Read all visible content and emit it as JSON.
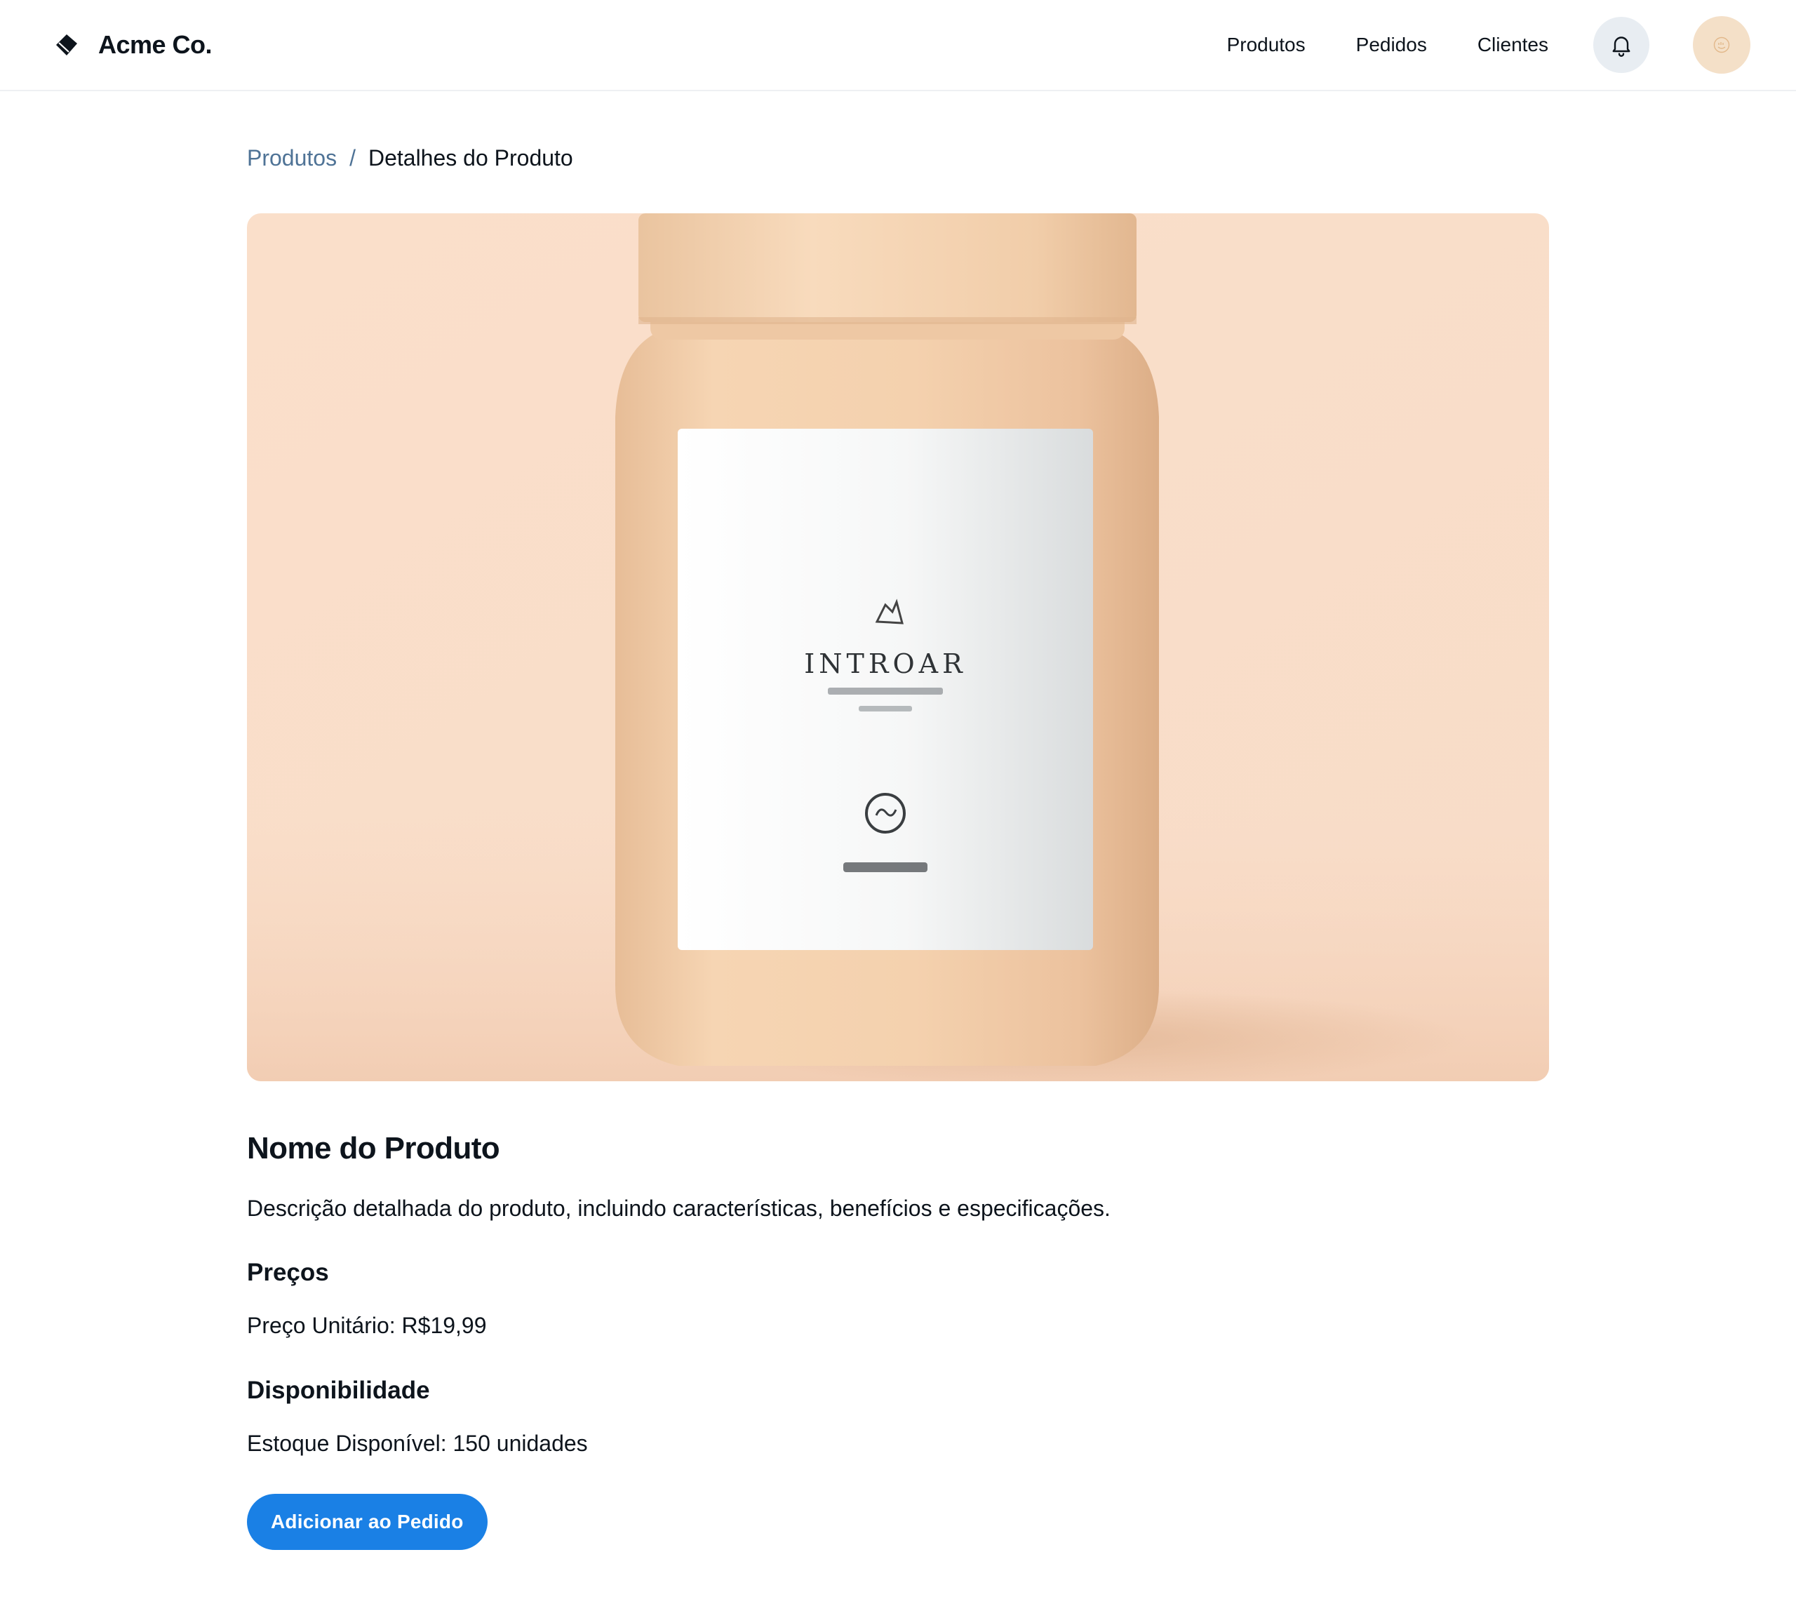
{
  "header": {
    "brand": "Acme Co.",
    "brand_icon": "diamond-logo-icon",
    "nav": [
      {
        "label": "Produtos"
      },
      {
        "label": "Pedidos"
      },
      {
        "label": "Clientes"
      }
    ],
    "notification_icon": "bell-icon",
    "avatar_icon": "user-avatar-icon"
  },
  "breadcrumb": {
    "parent": "Produtos",
    "separator": "/",
    "current": "Detalhes do Produto"
  },
  "product": {
    "image_alt": "product-jar-image",
    "label_text": "INTROAR",
    "name": "Nome do Produto",
    "description": "Descrição detalhada do produto, incluindo características, benefícios e especificações.",
    "pricing": {
      "title": "Preços",
      "text": "Preço Unitário: R$19,99"
    },
    "availability": {
      "title": "Disponibilidade",
      "text": "Estoque Disponível: 150 unidades"
    },
    "add_button": "Adicionar ao Pedido"
  },
  "colors": {
    "accent": "#1a80e5",
    "link": "#4f7396",
    "text": "#0d141c",
    "hero_background": "#f9dfcc",
    "jar": "#f3d2b0"
  }
}
